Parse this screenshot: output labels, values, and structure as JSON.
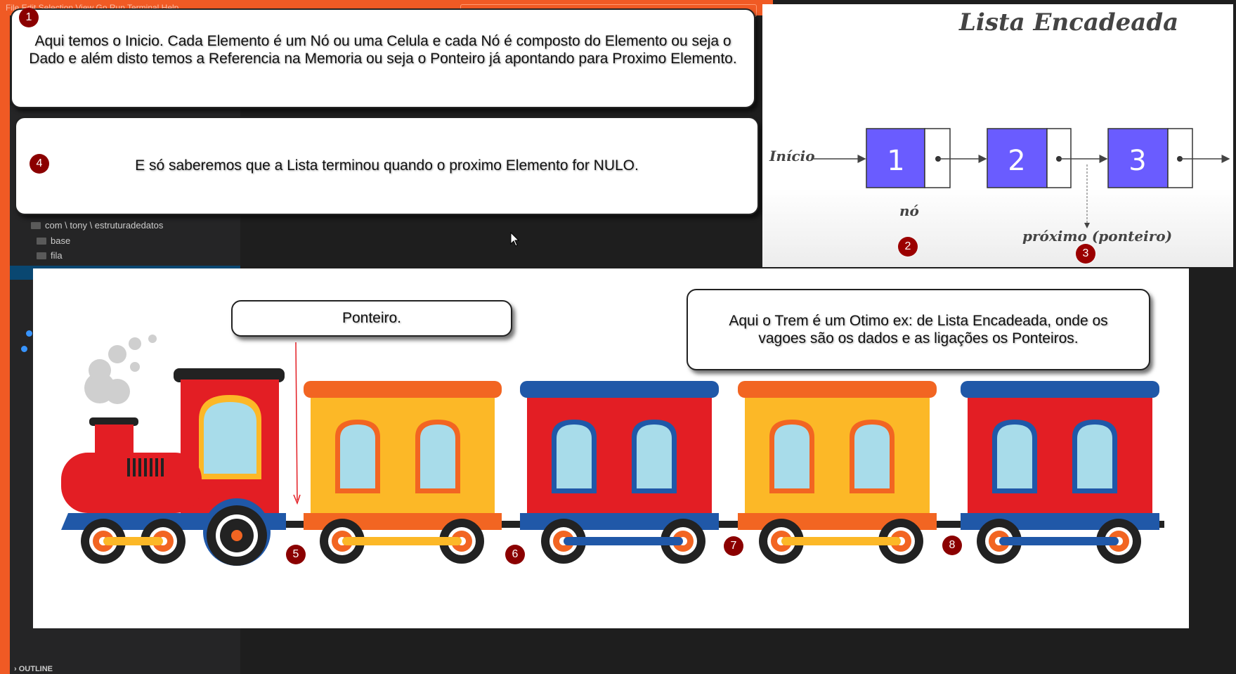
{
  "vscode": {
    "menu": "File  Edit  Selection  View  Go  Run  Terminal  Help",
    "explorer": {
      "path_item": "com \\ tony \\ estruturadedatos",
      "folders": [
        "base",
        "fila"
      ],
      "outline_label": "OUTLINE"
    }
  },
  "callouts": {
    "c1": {
      "number": "1",
      "text": "Aqui temos o Inicio. Cada Elemento é um Nó ou uma Celula e cada Nó é composto do Elemento ou seja o Dado e além disto temos a Referencia na Memoria ou seja o Ponteiro já apontando para Proximo Elemento."
    },
    "c4": {
      "number": "4",
      "text": "E só saberemos que a Lista terminou quando o proximo Elemento for NULO."
    },
    "ponteiro": {
      "text": "Ponteiro."
    },
    "trem": {
      "text": "Aqui o Trem é um Otimo ex: de Lista  Encadeada, onde os vagoes são os dados e as ligações os Ponteiros."
    }
  },
  "diagram": {
    "title": "Lista Encadeada",
    "start_label": "Início",
    "nodes": [
      "1",
      "2",
      "3"
    ],
    "node_label": "nó",
    "pointer_label": "próximo (ponteiro)",
    "badges": [
      "2",
      "3"
    ],
    "node_color": "#6a5cff"
  },
  "train": {
    "badges": [
      "5",
      "6",
      "7",
      "8"
    ],
    "colors": {
      "red": "#e31e24",
      "yellow": "#fcb827",
      "orange": "#f26522",
      "blue": "#2058a8",
      "window": "#a8dcea"
    }
  }
}
